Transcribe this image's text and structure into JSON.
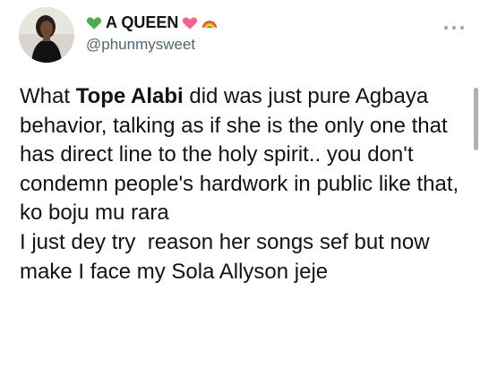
{
  "author": {
    "display_name": "A QUEEN",
    "handle": "@phunmysweet",
    "name_icons": [
      "green-heart-icon",
      "sparkling-heart-icon",
      "rainbow-icon"
    ]
  },
  "tweet": {
    "line1_prefix": "What ",
    "line1_bold": "Tope Alabi",
    "paragraph1_rest": " did was just pure Agbaya behavior, talking as if she is the only one that has direct line to the holy spirit.. you don't condemn people's hardwork in public like that, ko boju mu rara",
    "paragraph2": "I just dey try  reason her songs sef but now make I face my Sola Allyson jeje"
  },
  "colors": {
    "text": "#0f1419",
    "secondary": "#536471",
    "green_heart": "#4cae4c",
    "pink_heart": "#f06292"
  }
}
